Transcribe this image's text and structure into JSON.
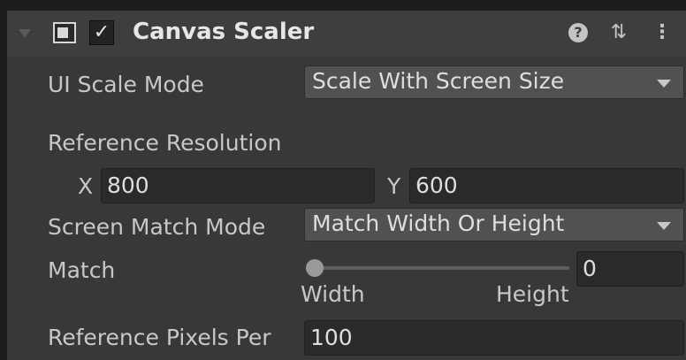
{
  "header": {
    "title": "Canvas Scaler",
    "enabled_check": "✓",
    "component_icon": "canvas-scaler-icon",
    "help_glyph": "?",
    "presets_glyph": "⇅",
    "more_glyph": "⋮"
  },
  "ui_scale_mode": {
    "label": "UI Scale Mode",
    "value": "Scale With Screen Size"
  },
  "reference_resolution": {
    "label": "Reference Resolution",
    "x_label": "X",
    "x_value": "800",
    "y_label": "Y",
    "y_value": "600"
  },
  "screen_match_mode": {
    "label": "Screen Match Mode",
    "value": "Match Width Or Height"
  },
  "match": {
    "label": "Match",
    "value": "0",
    "slider_fraction": 0,
    "min_label": "Width",
    "max_label": "Height"
  },
  "reference_pixels_per_unit": {
    "label": "Reference Pixels Per",
    "value": "100"
  }
}
